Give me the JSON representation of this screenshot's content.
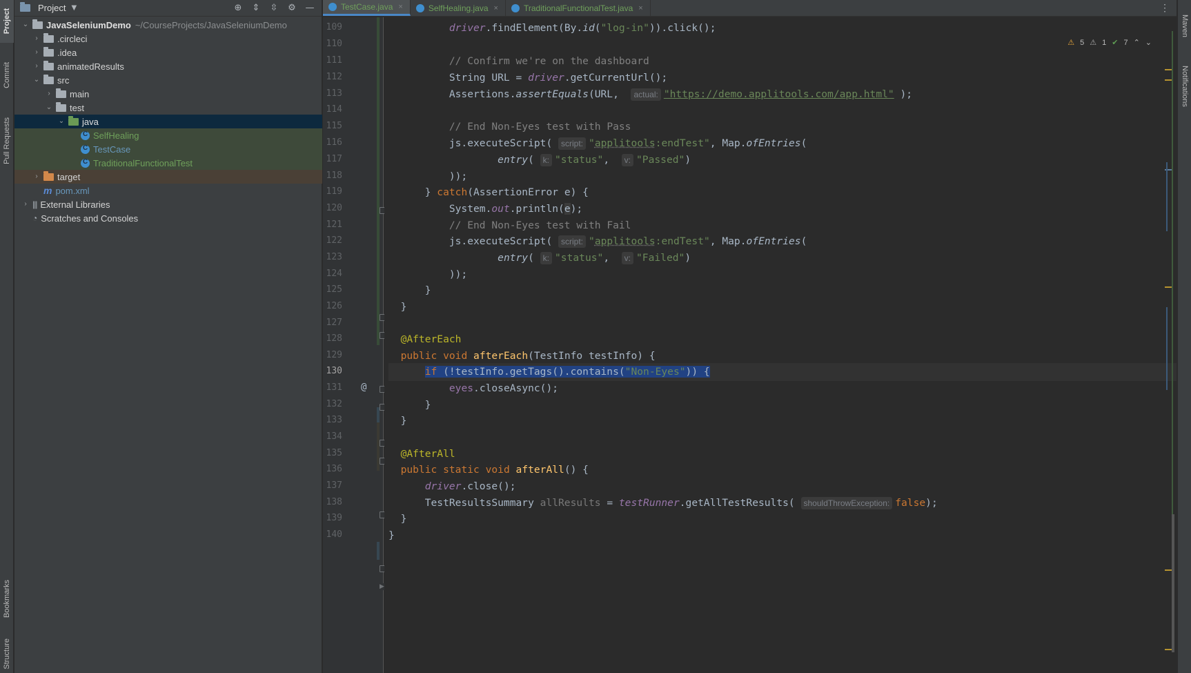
{
  "left_strip": {
    "tabs": [
      "Project",
      "Commit",
      "Pull Requests",
      "Bookmarks",
      "Structure"
    ]
  },
  "right_strip": {
    "tabs": [
      "Maven",
      "Notifications"
    ]
  },
  "project_panel": {
    "title": "Project",
    "tree": [
      {
        "label": "JavaSeleniumDemo",
        "path": "~/CourseProjects/JavaSeleniumDemo",
        "type": "module",
        "depth": 0,
        "expanded": true
      },
      {
        "label": ".circleci",
        "type": "folder",
        "depth": 1,
        "expanded": false
      },
      {
        "label": ".idea",
        "type": "folder",
        "depth": 1,
        "expanded": false
      },
      {
        "label": "animatedResults",
        "type": "folder",
        "depth": 1,
        "expanded": false
      },
      {
        "label": "src",
        "type": "folder",
        "depth": 1,
        "expanded": true
      },
      {
        "label": "main",
        "type": "folder",
        "depth": 2,
        "expanded": false
      },
      {
        "label": "test",
        "type": "folder",
        "depth": 2,
        "expanded": true
      },
      {
        "label": "java",
        "type": "test-source",
        "depth": 3,
        "expanded": true,
        "selected": true
      },
      {
        "label": "SelfHealing",
        "type": "class",
        "depth": 4
      },
      {
        "label": "TestCase",
        "type": "class",
        "depth": 4
      },
      {
        "label": "TraditionalFunctionalTest",
        "type": "class",
        "depth": 4
      },
      {
        "label": "target",
        "type": "excluded",
        "depth": 1,
        "expanded": false
      },
      {
        "label": "pom.xml",
        "type": "maven",
        "depth": 1
      },
      {
        "label": "External Libraries",
        "type": "library",
        "depth": 0,
        "expanded": false
      },
      {
        "label": "Scratches and Consoles",
        "type": "scratch",
        "depth": 0
      }
    ]
  },
  "tabs": [
    {
      "label": "TestCase.java",
      "active": true
    },
    {
      "label": "SelfHealing.java",
      "active": false
    },
    {
      "label": "TraditionalFunctionalTest.java",
      "active": false
    }
  ],
  "inspection": {
    "warnings": "5",
    "weak_warnings": "1",
    "typos": "7"
  },
  "editor": {
    "current_line": "130",
    "line_numbers": [
      "109",
      "110",
      "111",
      "112",
      "113",
      "114",
      "115",
      "116",
      "117",
      "118",
      "119",
      "120",
      "121",
      "122",
      "123",
      "124",
      "125",
      "126",
      "127",
      "128",
      "129",
      "130",
      "131",
      "132",
      "133",
      "134",
      "135",
      "136",
      "137",
      "138",
      "139",
      "140"
    ],
    "hints": {
      "actual": "actual:",
      "script": "script:",
      "k": "k:",
      "v": "v:",
      "shouldThrowException": "shouldThrowException:"
    },
    "strings": {
      "log_in": "\"log-in\"",
      "url": "\"https://demo.applitools.com/app.html\"",
      "applitools": "applitools",
      "end_test": ":endTest\"",
      "status": "\"status\"",
      "passed": "\"Passed\"",
      "failed": "\"Failed\"",
      "non_eyes": "\"Non-Eyes\""
    },
    "comments": {
      "c1": "// Confirm we're on the dashboard",
      "c2": "// End Non-Eyes test with Pass",
      "c3": "// End Non-Eyes test with Fail"
    }
  },
  "colors": {
    "background": "#2b2b2b",
    "keyword": "#cc7832",
    "string": "#6a8759",
    "annotation": "#bbb529",
    "method_decl": "#ffc66d",
    "field": "#9876aa",
    "selection": "#214283"
  }
}
